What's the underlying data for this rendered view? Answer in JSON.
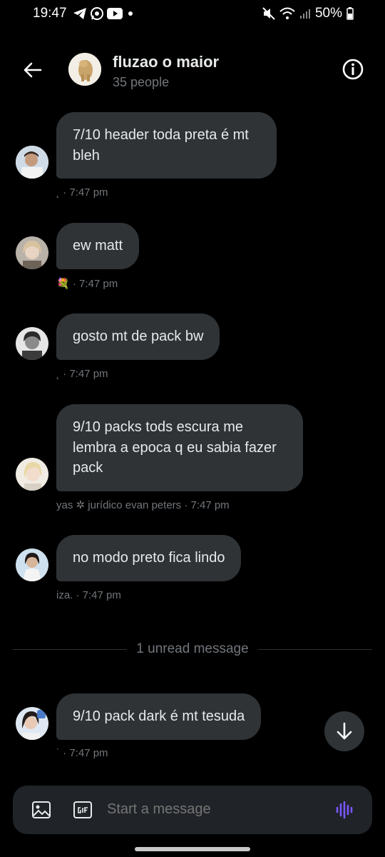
{
  "status_bar": {
    "time": "19:47",
    "battery": "50%"
  },
  "header": {
    "title": "fluzao o maior",
    "subtitle": "35 people"
  },
  "messages": [
    {
      "text": "7/10 header toda preta é mt\nbleh",
      "meta": "· 7:47 pm",
      "meta_prefix": "˛"
    },
    {
      "text": "ew matt",
      "meta": "· 7:47 pm",
      "meta_prefix": "💐"
    },
    {
      "text": "gosto mt de pack bw",
      "meta": "· 7:47 pm",
      "meta_prefix": "˛"
    },
    {
      "text": "9/10 packs tods escura me\nlembra a epoca q eu sabia fazer\npack",
      "meta": "yas ✲ jurídico evan peters · 7:47 pm",
      "meta_prefix": ""
    },
    {
      "text": "no modo preto fica lindo",
      "meta": "iza. · 7:47 pm",
      "meta_prefix": ""
    },
    {
      "text": "9/10 pack dark é mt tesuda",
      "meta": "· 7:47 pm",
      "meta_prefix": "˙"
    }
  ],
  "divider": {
    "label": "1 unread message"
  },
  "composer": {
    "placeholder": "Start a message"
  },
  "colors": {
    "background": "#000000",
    "bubble": "#2f3336",
    "muted_text": "#71767b",
    "voice_accent": "#7856ff"
  },
  "icons": {
    "back": "arrow-left-icon",
    "info": "info-circle-icon",
    "scroll_down": "arrow-down-icon",
    "media": "image-icon",
    "gif": "gif-icon",
    "voice": "voice-wave-icon"
  }
}
